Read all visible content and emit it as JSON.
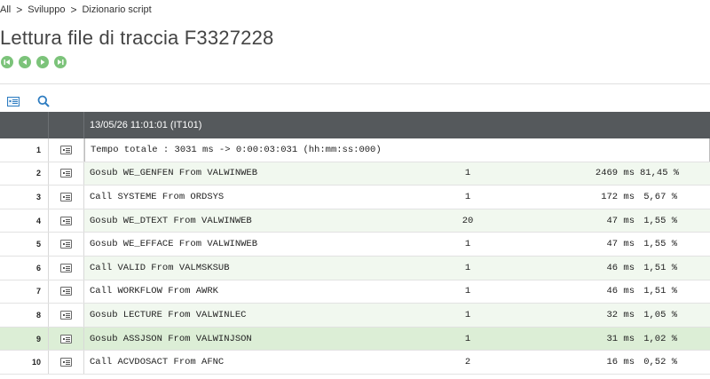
{
  "breadcrumb": {
    "items": [
      "All",
      "Sviluppo",
      "Dizionario script"
    ],
    "separator": ">"
  },
  "title": "Lettura file di traccia F3327228",
  "nav_icons": [
    "first-page-icon",
    "previous-page-icon",
    "next-page-icon",
    "last-page-icon"
  ],
  "toolbar_icons": [
    "detail-view-icon",
    "search-icon"
  ],
  "grid": {
    "header": "13/05/26 11:01:01 (IT101)",
    "rows": [
      {
        "num": "1",
        "label": "Tempo totale : 3031 ms -> 0:00:03:031 (hh:mm:ss:000)",
        "count": "",
        "ms": "",
        "pct": ""
      },
      {
        "num": "2",
        "label": "Gosub WE_GENFEN From VALWINWEB",
        "count": "1",
        "ms": "2469 ms",
        "pct": "81,45 %"
      },
      {
        "num": "3",
        "label": "Call SYSTEME From ORDSYS",
        "count": "1",
        "ms": "172 ms",
        "pct": "5,67 %"
      },
      {
        "num": "4",
        "label": "Gosub WE_DTEXT From VALWINWEB",
        "count": "20",
        "ms": "47 ms",
        "pct": "1,55 %"
      },
      {
        "num": "5",
        "label": "Gosub WE_EFFACE From VALWINWEB",
        "count": "1",
        "ms": "47 ms",
        "pct": "1,55 %"
      },
      {
        "num": "6",
        "label": "Call VALID From VALMSKSUB",
        "count": "1",
        "ms": "46 ms",
        "pct": "1,51 %"
      },
      {
        "num": "7",
        "label": "Call WORKFLOW From AWRK",
        "count": "1",
        "ms": "46 ms",
        "pct": "1,51 %"
      },
      {
        "num": "8",
        "label": "Gosub LECTURE From VALWINLEC",
        "count": "1",
        "ms": "32 ms",
        "pct": "1,05 %"
      },
      {
        "num": "9",
        "label": "Gosub ASSJSON From VALWINJSON",
        "count": "1",
        "ms": "31 ms",
        "pct": "1,02 %"
      },
      {
        "num": "10",
        "label": "Call ACVDOSACT From AFNC",
        "count": "2",
        "ms": "16 ms",
        "pct": "0,52 %"
      }
    ]
  },
  "colors": {
    "accent": "#7cc37a",
    "header_bg": "#55595c",
    "alt_row": "#f1f8ef",
    "selected_row": "#dceed6"
  }
}
